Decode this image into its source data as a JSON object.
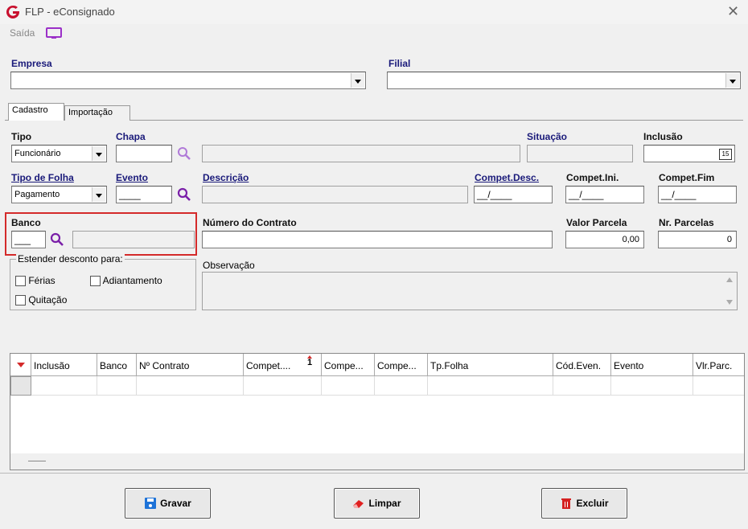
{
  "window": {
    "title": "FLP - eConsignado"
  },
  "toolbar": {
    "saida_label": "Saída"
  },
  "empresa": {
    "label": "Empresa",
    "value": ""
  },
  "filial": {
    "label": "Filial",
    "value": ""
  },
  "tabs": [
    {
      "label": "Cadastro",
      "active": true
    },
    {
      "label": "Importação",
      "active": false
    }
  ],
  "form": {
    "tipo_label": "Tipo",
    "tipo_value": "Funcionário",
    "chapa_label": "Chapa",
    "chapa_value": "",
    "situacao_label": "Situação",
    "situacao_value": "",
    "inclusao_label": "Inclusão",
    "inclusao_value": "",
    "calendar_text": "15",
    "tipo_folha_label": "Tipo de Folha",
    "tipo_folha_value": "Pagamento",
    "evento_label": "Evento",
    "evento_mask": "____",
    "descricao_label": "Descrição",
    "descricao_value": "",
    "compet_desc_label": "Compet.Desc.",
    "compet_desc_mask": "__/____",
    "compet_ini_label": "Compet.Ini.",
    "compet_ini_mask": "__/____",
    "compet_fim_label": "Compet.Fim",
    "compet_fim_mask": "__/____",
    "banco_label": "Banco",
    "banco_mask": "___",
    "numero_contrato_label": "Número do Contrato",
    "numero_contrato_value": "",
    "valor_parcela_label": "Valor Parcela",
    "valor_parcela_value": "0,00",
    "nr_parcelas_label": "Nr. Parcelas",
    "nr_parcelas_value": "0",
    "estender_label": "Estender desconto para:",
    "ferias_label": "Férias",
    "adiantamento_label": "Adiantamento",
    "quitacao_label": "Quitação",
    "observacao_label": "Observação",
    "observacao_value": ""
  },
  "grid": {
    "columns": [
      "Inclusão",
      "Banco",
      "Nº Contrato",
      "Compet....",
      "Compe...",
      "Compe...",
      "Tp.Folha",
      "Cód.Even.",
      "Evento",
      "Vlr.Parc."
    ],
    "sort_indicator": "1",
    "rows": []
  },
  "buttons": {
    "gravar": "Gravar",
    "limpar": "Limpar",
    "excluir": "Excluir"
  },
  "colors": {
    "label_blue": "#1a1a7a",
    "highlight_red": "#d42a2a",
    "accent_purple": "#9b30c8",
    "logo_red": "#c8102e"
  }
}
